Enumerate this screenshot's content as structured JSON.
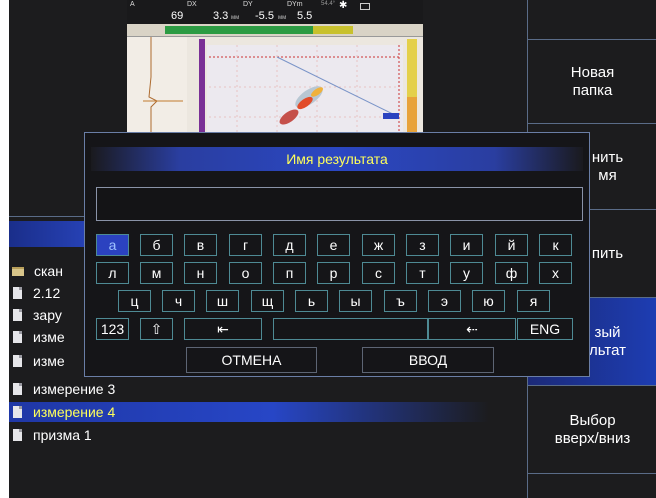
{
  "scan_header": {
    "label_a": "A",
    "value_a": "69",
    "label_dx": "DX",
    "value_dx": "3.3",
    "label_dy": "DY",
    "value_dy": "-5.5",
    "label_dym": "DYm",
    "value_dym": "5.5",
    "unit_mm": "мм",
    "angle": "54.4°"
  },
  "right_menu": [
    {
      "label": ""
    },
    {
      "label": "Новая\nпапка"
    },
    {
      "label": "нить\nмя"
    },
    {
      "label": "пить"
    },
    {
      "label": "зый\nльтат"
    },
    {
      "label": "Выбор\nвверх/вниз"
    },
    {
      "label": ""
    }
  ],
  "file_list": [
    {
      "name": "скан"
    },
    {
      "name": "2.12"
    },
    {
      "name": "зару"
    },
    {
      "name": "изме"
    },
    {
      "name": "изме"
    },
    {
      "name": "измерение 3"
    },
    {
      "name": "измерение 4"
    },
    {
      "name": "призма 1"
    }
  ],
  "dialog": {
    "title": "Имя результата",
    "input_value": "",
    "row1": [
      "а",
      "б",
      "в",
      "г",
      "д",
      "е",
      "ж",
      "з",
      "и",
      "й",
      "к"
    ],
    "row2": [
      "л",
      "м",
      "н",
      "о",
      "п",
      "р",
      "с",
      "т",
      "у",
      "ф",
      "х"
    ],
    "row3": [
      "ц",
      "ч",
      "ш",
      "щ",
      "ь",
      "ы",
      "ъ",
      "э",
      "ю",
      "я"
    ],
    "key_123": "123",
    "key_shift": "⇧",
    "key_left": "⇤",
    "key_space": "",
    "key_backspace": "⇠",
    "key_lang": "ENG",
    "cancel_label": "ОТМЕНА",
    "enter_label": "ВВОД"
  },
  "colors": {
    "accent_blue": "#2b42c0",
    "highlight_yellow": "#ffff5a",
    "key_border": "#4e8a94"
  }
}
